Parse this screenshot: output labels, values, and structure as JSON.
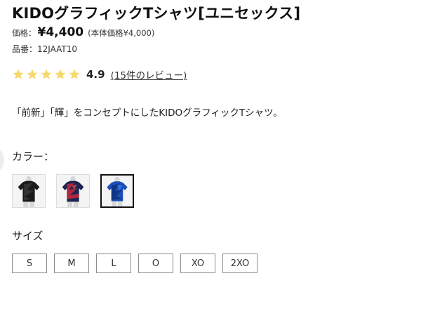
{
  "product": {
    "title": "KIDOグラフィックTシャツ[ユニセックス]",
    "price_label": "価格：",
    "price": "¥4,400",
    "base_price": "(本体価格¥4,000)",
    "sku_label": "品番：",
    "sku": "12JAAT10",
    "description": "「前新」「輝」をコンセプトにしたKIDOグラフィックTシャツ。"
  },
  "rating": {
    "stars": 5,
    "score": "4.9",
    "review_link": "(15件のレビュー)",
    "star_color": "#f5d86e"
  },
  "color": {
    "label": "カラー：",
    "swatches": [
      {
        "icon": "tshirt-black-icon",
        "selected": false
      },
      {
        "icon": "tshirt-navy-red-icon",
        "selected": false
      },
      {
        "icon": "tshirt-blue-icon",
        "selected": true
      }
    ]
  },
  "size": {
    "label": "サイズ",
    "options": [
      "S",
      "M",
      "L",
      "O",
      "XO",
      "2XO"
    ]
  }
}
